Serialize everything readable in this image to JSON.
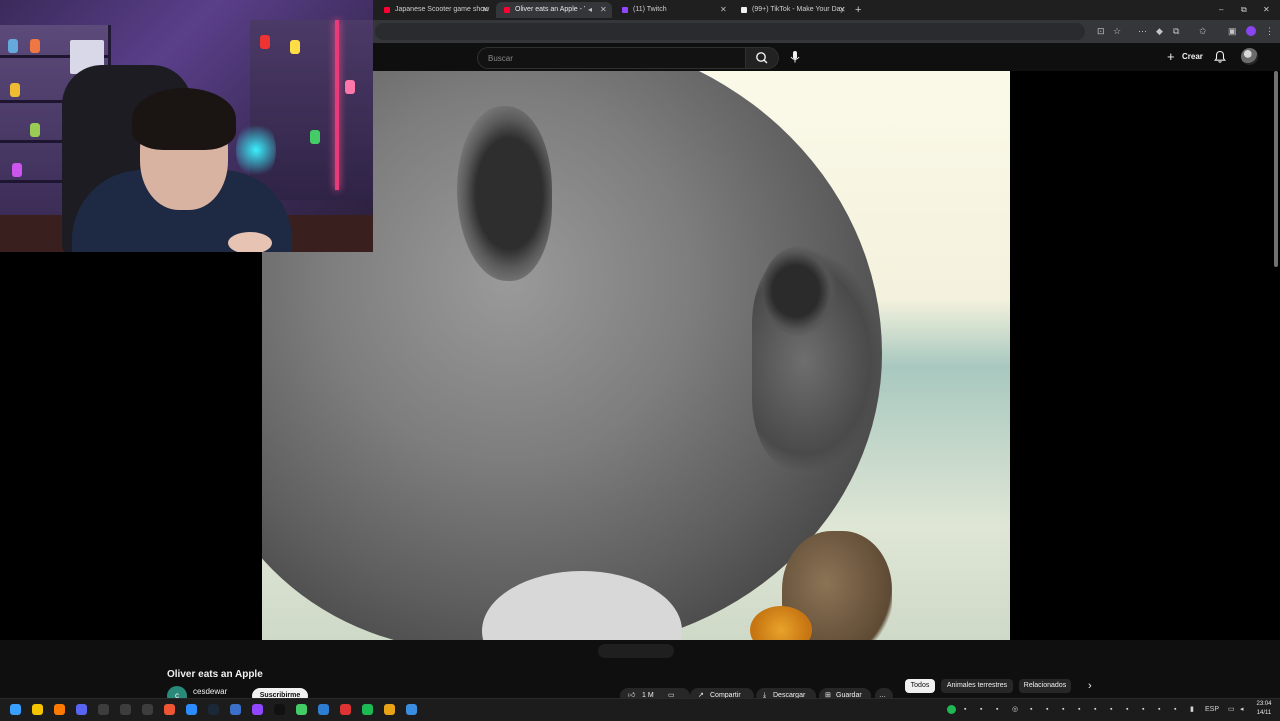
{
  "browser": {
    "tabs": [
      {
        "title": "Japanese Scooter game show",
        "favicon_color": "#ff0033",
        "active": false
      },
      {
        "title": "Oliver eats an Apple - YouT",
        "favicon_color": "#ff0033",
        "active": true
      },
      {
        "title": "(11) Twitch",
        "favicon_color": "#9146ff",
        "active": false
      },
      {
        "title": "(99+) TikTok - Make Your Day",
        "favicon_color": "#ffffff",
        "active": false
      }
    ],
    "new_tab_label": "+",
    "window_controls": {
      "minimize": "–",
      "maximize": "⧉",
      "close": "✕"
    }
  },
  "youtube": {
    "search": {
      "placeholder": "Buscar",
      "value": ""
    },
    "create_label": "Crear",
    "video": {
      "title": "Oliver eats an Apple",
      "channel": "cesdewar",
      "channel_initial": "c",
      "subscribe_label": "Suscribirme",
      "actions": [
        {
          "icon": "like-icon",
          "label": "1 M"
        },
        {
          "icon": "dislike-icon",
          "label": ""
        },
        {
          "icon": "share-icon",
          "label": "Compartir"
        },
        {
          "icon": "download-icon",
          "label": "Descargar"
        },
        {
          "icon": "save-icon",
          "label": "Guardar"
        },
        {
          "icon": "more-icon",
          "label": "…"
        }
      ]
    },
    "chips": [
      "Todos",
      "Animales terrestres",
      "Relacionados"
    ]
  },
  "taskbar": {
    "tray": {
      "language": "ESP"
    },
    "clock": {
      "time": "23:04",
      "date": "14/11"
    }
  },
  "colors": {
    "youtube_red": "#ff0033",
    "accent_purple": "#8a44f0",
    "background": "#0f0f0f"
  }
}
